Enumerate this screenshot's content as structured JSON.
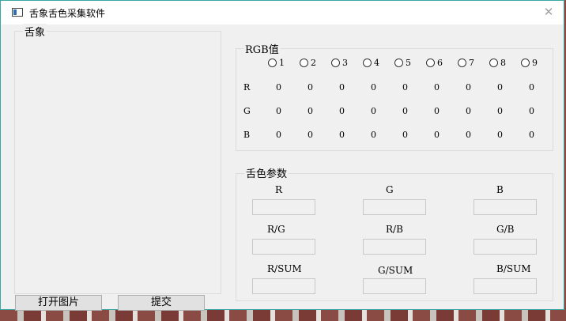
{
  "window": {
    "title": "舌象舌色采集软件",
    "close_symbol": "✕"
  },
  "tongue_panel": {
    "title": "舌象"
  },
  "buttons": {
    "open_image": "打开图片",
    "submit": "提交"
  },
  "rgb_panel": {
    "title": "RGB值",
    "radios": [
      "1",
      "2",
      "3",
      "4",
      "5",
      "6",
      "7",
      "8",
      "9"
    ],
    "row_labels": [
      "R",
      "G",
      "B"
    ],
    "values": [
      [
        "0",
        "0",
        "0",
        "0",
        "0",
        "0",
        "0",
        "0",
        "0"
      ],
      [
        "0",
        "0",
        "0",
        "0",
        "0",
        "0",
        "0",
        "0",
        "0"
      ],
      [
        "0",
        "0",
        "0",
        "0",
        "0",
        "0",
        "0",
        "0",
        "0"
      ]
    ]
  },
  "params_panel": {
    "title": "舌色参数",
    "labels": [
      "R",
      "G",
      "B",
      "R/G",
      "R/B",
      "G/B",
      "R/SUM",
      "G/SUM",
      "B/SUM"
    ],
    "values": [
      "",
      "",
      "",
      "",
      "",
      "",
      "",
      "",
      ""
    ]
  },
  "icons": {
    "app": "app-window-icon",
    "close": "close-icon",
    "radio": "radio-circle-icon"
  },
  "colors": {
    "window_border": "#3aa6a6",
    "window_bg": "#f0f0f0",
    "titlebar_bg": "#ffffff"
  }
}
